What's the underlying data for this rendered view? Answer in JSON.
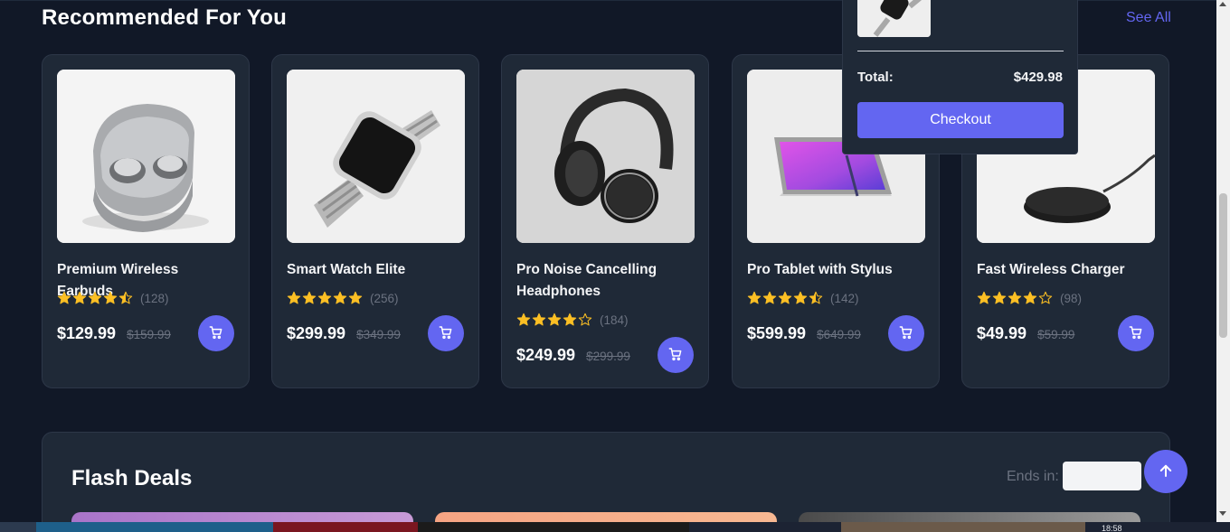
{
  "header": {
    "title": "Recommended For You",
    "see_all": "See All"
  },
  "products": [
    {
      "name": "Premium Wireless Earbuds",
      "rating": 4.5,
      "reviews": "(128)",
      "price": "$129.99",
      "old_price": "$159.99",
      "image": "earbuds"
    },
    {
      "name": "Smart Watch Elite",
      "rating": 5,
      "reviews": "(256)",
      "price": "$299.99",
      "old_price": "$349.99",
      "image": "smart-watch"
    },
    {
      "name": "Pro Noise Cancelling Headphones",
      "rating": 4,
      "reviews": "(184)",
      "price": "$249.99",
      "old_price": "$299.99",
      "image": "headphones"
    },
    {
      "name": "Pro Tablet with Stylus",
      "rating": 4.5,
      "reviews": "(142)",
      "price": "$599.99",
      "old_price": "$649.99",
      "image": "tablet"
    },
    {
      "name": "Fast Wireless Charger",
      "rating": 4,
      "reviews": "(98)",
      "price": "$49.99",
      "old_price": "$59.99",
      "image": "wireless-charger"
    }
  ],
  "cart": {
    "total_label": "Total:",
    "total_value": "$429.98",
    "checkout_label": "Checkout"
  },
  "flash_deals": {
    "title": "Flash Deals",
    "ends_label": "Ends in:"
  },
  "taskbar": {
    "clock": "18:58"
  },
  "colors": {
    "background": "#111827",
    "card": "#1f2937",
    "accent": "#6366f1",
    "star": "#fbbf24",
    "muted": "#6b7280"
  },
  "icons": [
    "cart-icon",
    "star-icon",
    "arrow-up-icon"
  ]
}
